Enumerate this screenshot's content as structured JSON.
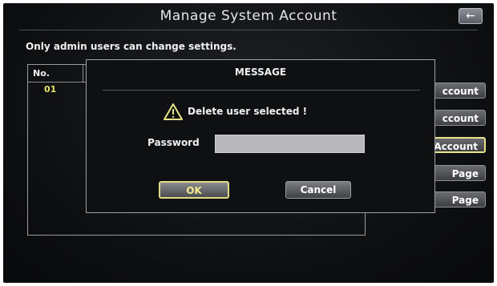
{
  "header": {
    "title": "Manage System Account",
    "back_icon": "arrow-left-icon"
  },
  "notice": "Only admin users can change settings.",
  "table": {
    "columns": [
      "No."
    ],
    "rows": [
      {
        "no": "01"
      }
    ]
  },
  "side_buttons": [
    "ccount",
    "ccount",
    "Account",
    "Page",
    "Page"
  ],
  "dialog": {
    "title": "MESSAGE",
    "warning_icon": "warning-icon",
    "message": "Delete user selected !",
    "password_label": "Password",
    "password_value": "",
    "ok_label": "OK",
    "cancel_label": "Cancel"
  },
  "colors": {
    "accent_yellow": "#e7e389",
    "text": "#f0f0f0",
    "background": "#0d0e10"
  }
}
